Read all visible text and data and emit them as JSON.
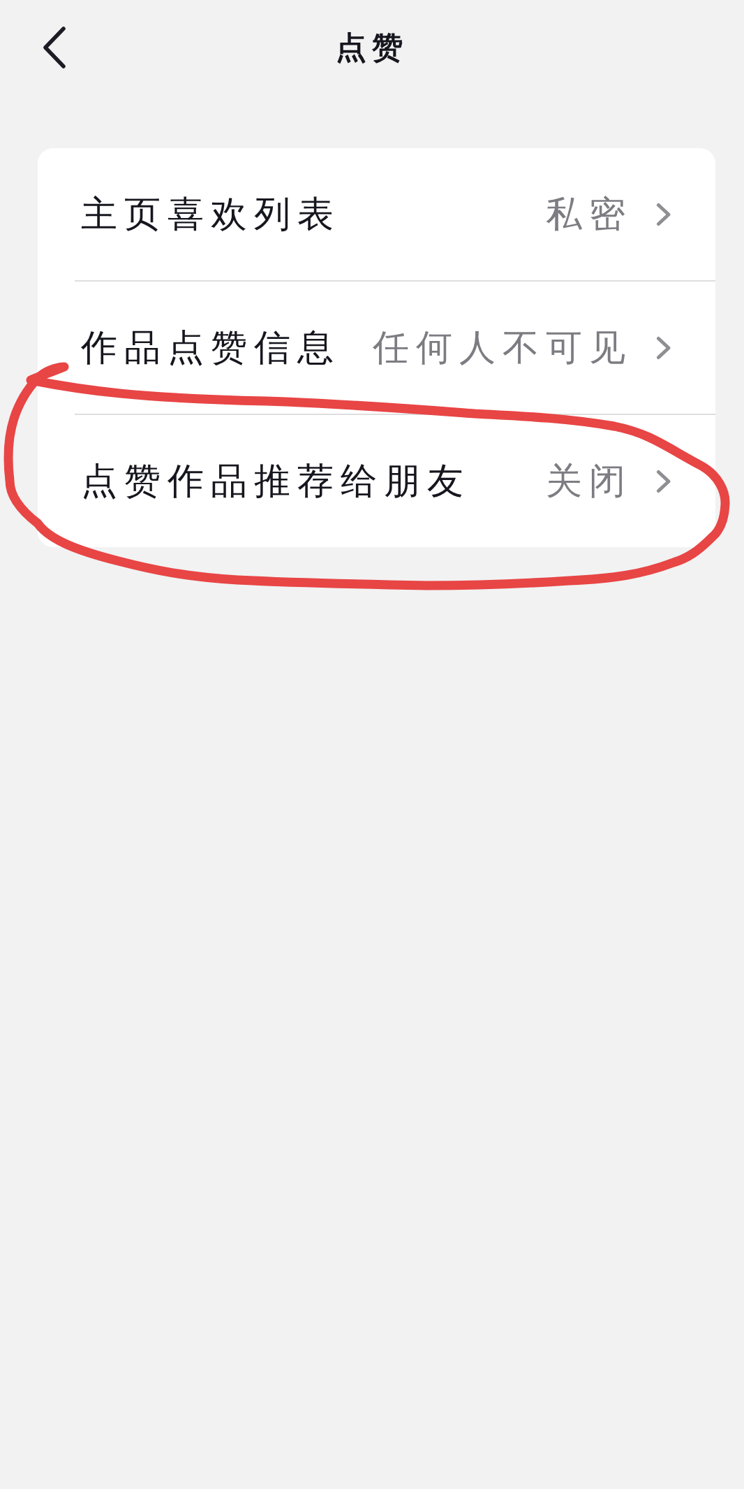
{
  "header": {
    "title": "点赞"
  },
  "settings": [
    {
      "label": "主页喜欢列表",
      "value": "私密",
      "highlighted": false
    },
    {
      "label": "作品点赞信息",
      "value": "任何人不可见",
      "highlighted": false
    },
    {
      "label": "点赞作品推荐给朋友",
      "value": "关闭",
      "highlighted": true
    }
  ]
}
